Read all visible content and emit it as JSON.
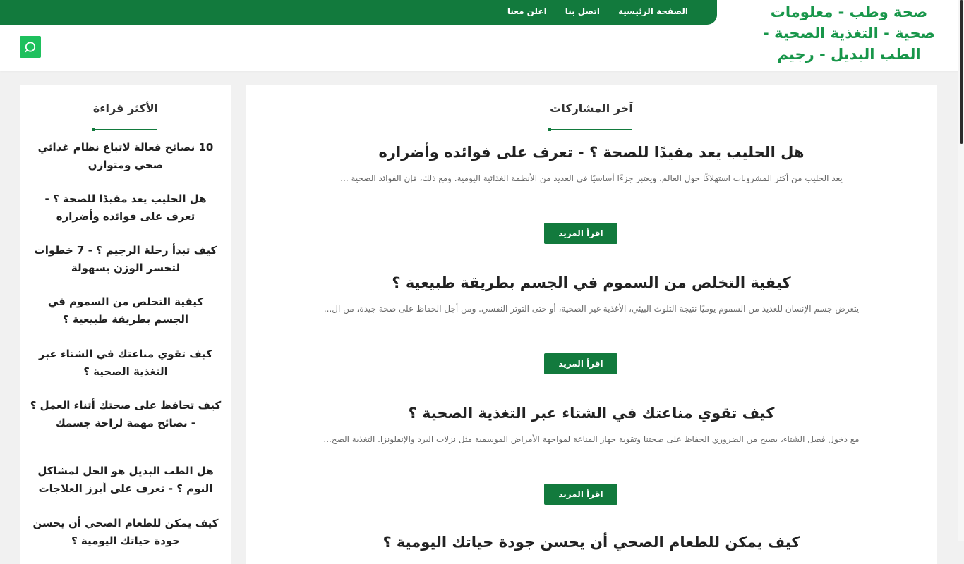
{
  "site": {
    "logo_text": "صحة وطب - معلومات صحية - التغذية الصحية - الطب البديل - رجيم"
  },
  "topnav": {
    "items": [
      {
        "label": "الصفحة الرئيسية"
      },
      {
        "label": "اتصل بنا"
      },
      {
        "label": "اعلن معنا"
      }
    ]
  },
  "search": {
    "icon": "search-icon"
  },
  "main": {
    "title": "آخر المشاركات",
    "read_more_label": "اقرأ المزيد",
    "posts": [
      {
        "title": "هل الحليب يعد مفيدًا للصحة ؟ - تعرف على فوائده وأضراره",
        "excerpt": "يعد الحليب من أكثر المشروبات استهلاكًا حول العالم، ويعتبر جزءًا أساسيًا في العديد من الأنظمة الغذائية اليومية. ومع ذلك، فإن الفوائد الصحية ..."
      },
      {
        "title": "كيفية التخلص من السموم في الجسم بطريقة طبيعية ؟",
        "excerpt": "يتعرض جسم الإنسان للعديد من السموم يوميًا نتيجة التلوث البيئي، الأغذية غير الصحية، أو حتى التوتر النفسي. ومن أجل الحفاظ على صحة جيدة، من ال..."
      },
      {
        "title": "كيف تقوي مناعتك في الشتاء عبر التغذية الصحية ؟",
        "excerpt": "مع دخول فصل الشتاء، يصبح من الضروري الحفاظ على صحتنا وتقوية جهاز المناعة لمواجهة الأمراض الموسمية مثل نزلات البرد والإنفلونزا. التغذية الصح..."
      },
      {
        "title": "كيف يمكن للطعام الصحي أن يحسن جودة حياتك اليومية ؟",
        "excerpt": ""
      }
    ]
  },
  "sidebar": {
    "title": "الأكثر قراءة",
    "items": [
      {
        "label": "10 نصائح فعالة لاتباع نظام غذائي صحي ومتوازن"
      },
      {
        "label": "هل الحليب يعد مفيدًا للصحة ؟ - تعرف على فوائده وأضراره"
      },
      {
        "label": "كيف تبدأ رحلة الرجيم ؟ - 7 خطوات لتخسر الوزن بسهولة"
      },
      {
        "label": "كيفية التخلص من السموم في الجسم بطريقة طبيعية ؟"
      },
      {
        "label": "كيف تقوي مناعتك في الشتاء عبر التغذية الصحية ؟"
      },
      {
        "label": "كيف تحافظ على صحتك أثناء العمل ؟ - نصائح مهمة لراحة جسمك"
      },
      {
        "label": "هل الطب البديل هو الحل لمشاكل النوم ؟ - تعرف على أبرز العلاجات"
      },
      {
        "label": "كيف يمكن للطعام الصحي أن يحسن جودة حياتك اليومية ؟"
      }
    ]
  },
  "colors": {
    "brand_green": "#127a3d",
    "logo_green": "#18964a",
    "search_green": "#1ec05d"
  }
}
